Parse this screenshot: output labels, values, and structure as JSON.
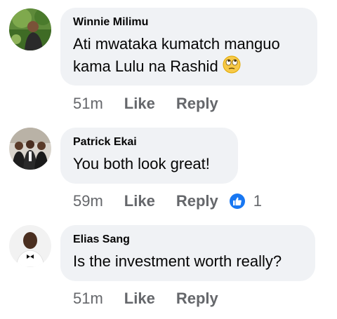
{
  "comments": [
    {
      "author": "Winnie Milimu",
      "text_line1": "Ati mwataka kumatch manguo",
      "text_line2": "kama Lulu na Rashid",
      "emoji": "rolling-eyes-emoji",
      "time": "51m",
      "like_label": "Like",
      "reply_label": "Reply"
    },
    {
      "author": "Patrick Ekai",
      "text": "You both look great!",
      "time": "59m",
      "like_label": "Like",
      "reply_label": "Reply",
      "reaction": {
        "icon": "thumbs-up-icon",
        "count": "1",
        "color": "#1877f2"
      }
    },
    {
      "author": "Elias Sang",
      "text": "Is the investment worth really?",
      "time": "51m",
      "like_label": "Like",
      "reply_label": "Reply"
    }
  ],
  "colors": {
    "bubble": "#f0f2f5",
    "text": "#050505",
    "meta": "#65676b",
    "accent": "#1877f2"
  }
}
